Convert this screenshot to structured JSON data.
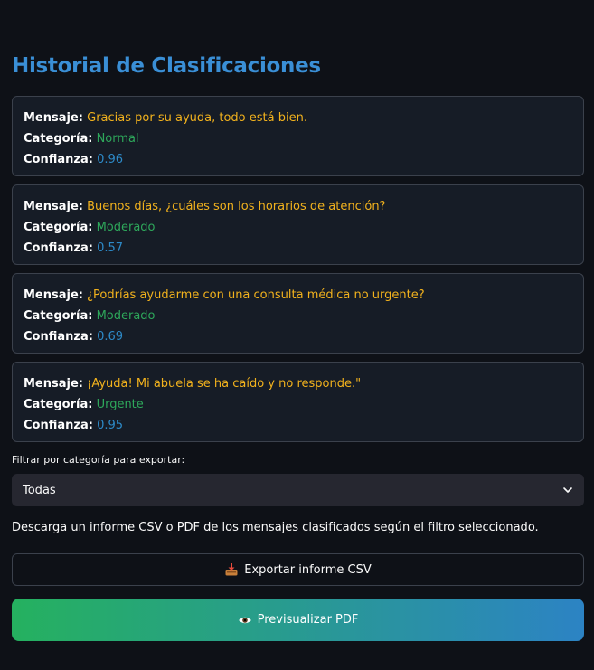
{
  "header": {
    "title": "Historial de Clasificaciones"
  },
  "labels": {
    "message": "Mensaje:",
    "category": "Categoría:",
    "confidence": "Confianza:"
  },
  "records": [
    {
      "message": "Gracias por su ayuda, todo está bien.",
      "category": "Normal",
      "confidence": "0.96"
    },
    {
      "message": "Buenos días, ¿cuáles son los horarios de atención?",
      "category": "Moderado",
      "confidence": "0.57"
    },
    {
      "message": "¿Podrías ayudarme con una consulta médica no urgente?",
      "category": "Moderado",
      "confidence": "0.69"
    },
    {
      "message": "¡Ayuda! Mi abuela se ha caído y no responde.\"",
      "category": "Urgente",
      "confidence": "0.95"
    }
  ],
  "filter": {
    "label": "Filtrar por categoría para exportar:",
    "selected": "Todas",
    "icon": "chevron-down-icon"
  },
  "export": {
    "description": "Descarga un informe CSV o PDF de los mensajes clasificados según el filtro seleccionado.",
    "csv_label": "Exportar informe CSV",
    "csv_icon": "inbox-tray-icon",
    "pdf_label": "Previsualizar PDF",
    "pdf_icon": "eye-icon"
  },
  "colors": {
    "background": "#0e1117",
    "title": "#3a8fd6",
    "message": "#f2b21d",
    "category": "#2ea85b",
    "confidence": "#2d8ac8",
    "gradient_start": "#25b15f",
    "gradient_end": "#2c83c4"
  }
}
